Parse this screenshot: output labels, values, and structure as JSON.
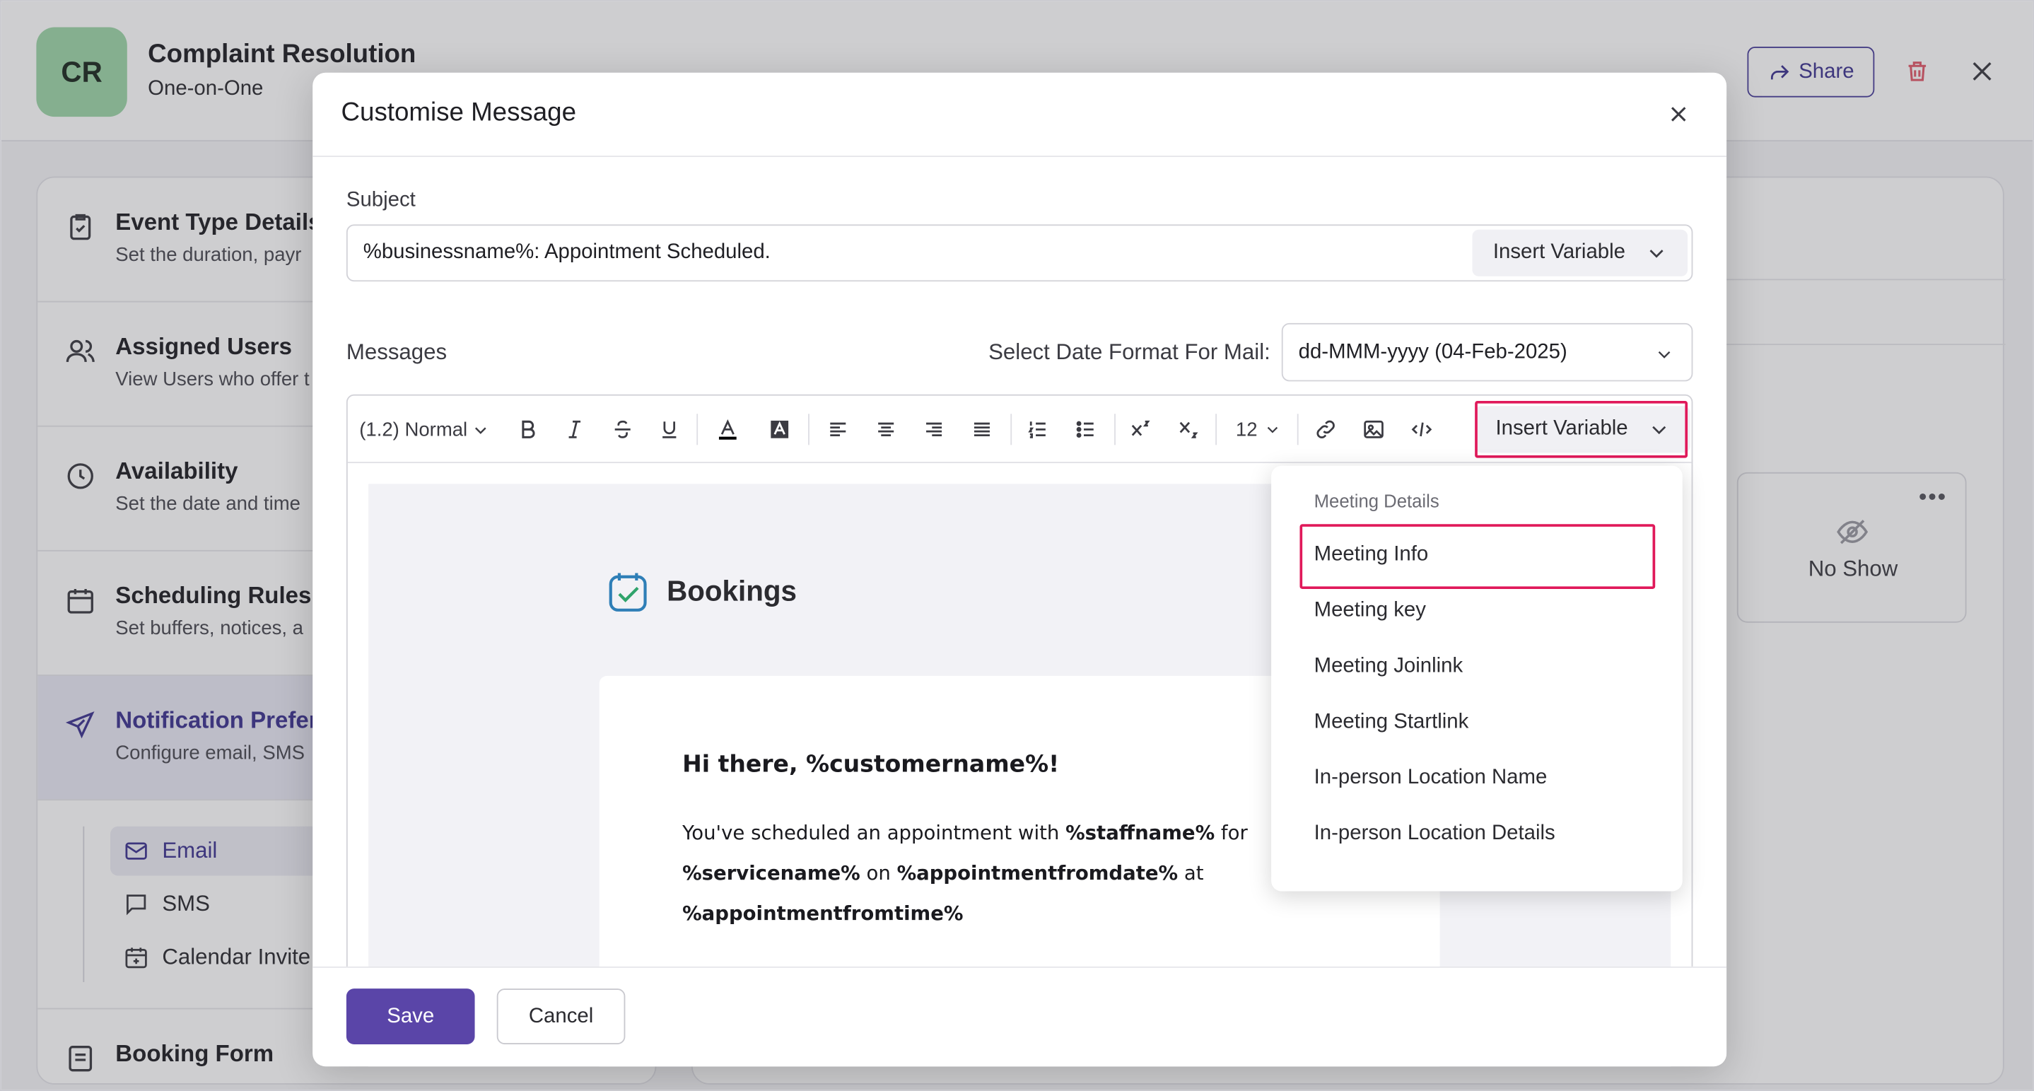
{
  "event": {
    "avatar_initials": "CR",
    "title": "Complaint Resolution",
    "subtitle": "One-on-One",
    "share_label": "Share"
  },
  "sidebar": {
    "items": [
      {
        "title": "Event Type Details",
        "desc": "Set the duration, payr",
        "icon": "clipboard-icon"
      },
      {
        "title": "Assigned Users",
        "desc": "View Users who offer t",
        "icon": "users-icon"
      },
      {
        "title": "Availability",
        "desc": "Set the date and time",
        "icon": "clock-icon"
      },
      {
        "title": "Scheduling Rules",
        "desc": "Set buffers, notices, a",
        "icon": "calendar-icon"
      },
      {
        "title": "Notification Prefere",
        "desc": "Configure email, SMS",
        "icon": "send-icon"
      },
      {
        "title": "Booking Form",
        "desc": "",
        "icon": "form-icon"
      }
    ],
    "sub_items": [
      {
        "label": "Email",
        "icon": "mail-icon"
      },
      {
        "label": "SMS",
        "icon": "chat-icon"
      },
      {
        "label": "Calendar Invite",
        "icon": "calendar-add-icon"
      }
    ]
  },
  "no_show": {
    "label": "No Show"
  },
  "modal": {
    "title": "Customise Message",
    "subject_label": "Subject",
    "subject_value": "%businessname%: Appointment Scheduled.",
    "insert_variable_label": "Insert Variable",
    "messages_label": "Messages",
    "date_format_label": "Select Date Format For Mail:",
    "date_format_value": "dd-MMM-yyyy (04-Feb-2025)",
    "toolbar": {
      "line_style": "(1.2) Normal",
      "font_size": "12",
      "insert_variable_label": "Insert Variable"
    },
    "preview": {
      "brand": "Bookings",
      "greeting": "Hi there, %customername%!",
      "line1_pre": "You've scheduled an appointment with ",
      "line1_var": "%staffname%",
      "line1_post": " for",
      "line2_var1": "%servicename%",
      "line2_mid": " on ",
      "line2_var2": "%appointmentfromdate%",
      "line2_post": " at",
      "line3_var": "%appointmentfromtime%"
    },
    "save_label": "Save",
    "cancel_label": "Cancel"
  },
  "dropdown": {
    "group_label": "Meeting Details",
    "items": [
      "Meeting Info",
      "Meeting key",
      "Meeting Joinlink",
      "Meeting Startlink",
      "In-person Location Name",
      "In-person Location Details"
    ]
  },
  "colors": {
    "accent": "#5a45a8",
    "highlight": "#e0195a",
    "avatar": "#9ed6a8"
  }
}
